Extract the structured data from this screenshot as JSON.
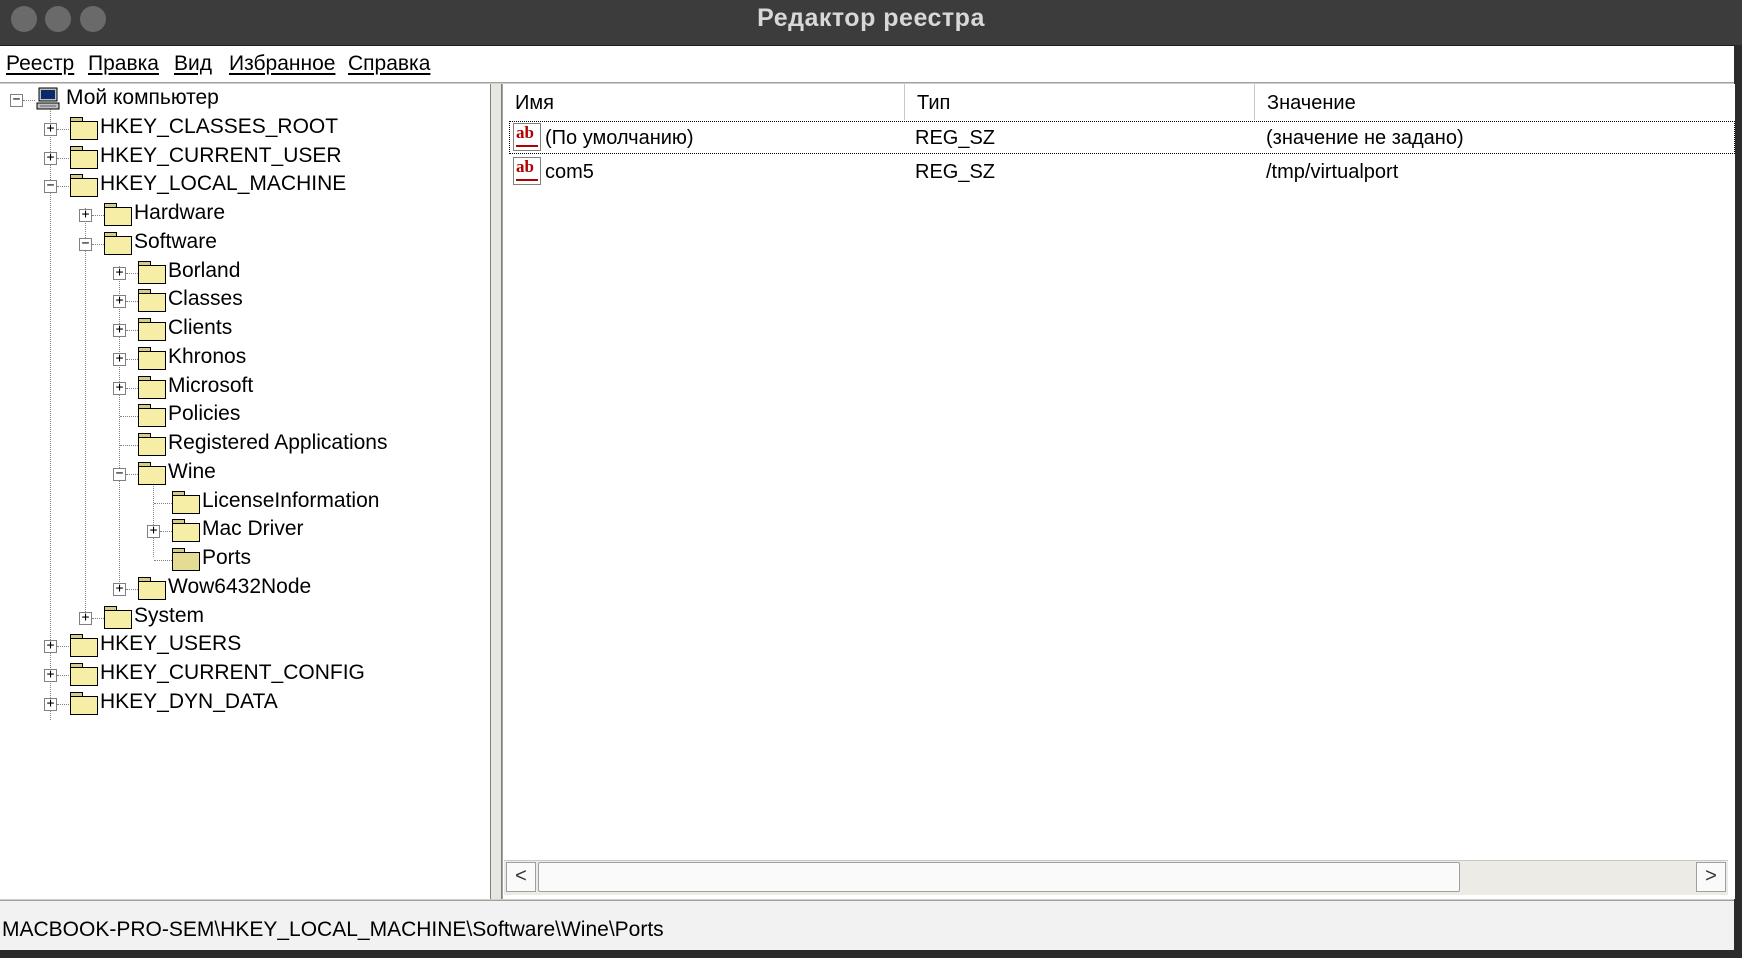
{
  "window": {
    "title": "Редактор реестра"
  },
  "menu": [
    "Реестр",
    "Правка",
    "Вид",
    "Избранное",
    "Справка"
  ],
  "tree": {
    "root": "Мой компьютер",
    "nodes": [
      "HKEY_CLASSES_ROOT",
      "HKEY_CURRENT_USER",
      "HKEY_LOCAL_MACHINE",
      "Hardware",
      "Software",
      "Borland",
      "Classes",
      "Clients",
      "Khronos",
      "Microsoft",
      "Policies",
      "Registered Applications",
      "Wine",
      "LicenseInformation",
      "Mac Driver",
      "Ports",
      "Wow6432Node",
      "System",
      "HKEY_USERS",
      "HKEY_CURRENT_CONFIG",
      "HKEY_DYN_DATA"
    ],
    "expanded": [
      "HKEY_LOCAL_MACHINE",
      "Software",
      "Wine"
    ],
    "selected": "Ports"
  },
  "list": {
    "columns": [
      "Имя",
      "Тип",
      "Значение"
    ],
    "rows": [
      {
        "icon": "string-value-icon",
        "icon_text": "ab",
        "name": "(По умолчанию)",
        "type": "REG_SZ",
        "value": "(значение не задано)"
      },
      {
        "icon": "string-value-icon",
        "icon_text": "ab",
        "name": "com5",
        "type": "REG_SZ",
        "value": "/tmp/virtualport"
      }
    ]
  },
  "scrollbar": {
    "left_arrow": "<",
    "right_arrow": ">"
  },
  "status": {
    "path": "MACBOOK-PRO-SEM\\HKEY_LOCAL_MACHINE\\Software\\Wine\\Ports"
  }
}
